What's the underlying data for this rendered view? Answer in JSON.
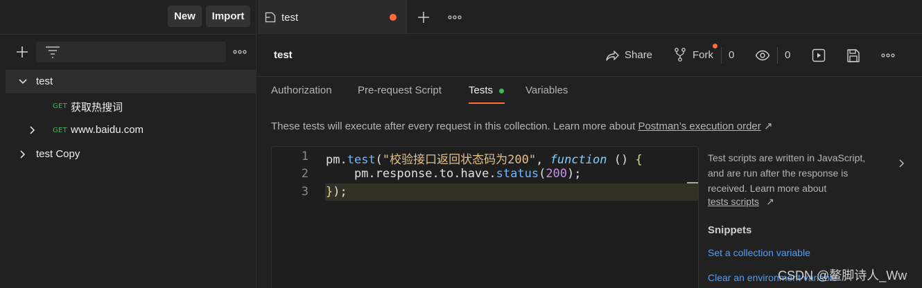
{
  "sidebar": {
    "new_label": "New",
    "import_label": "Import",
    "search_placeholder": "",
    "tree": [
      {
        "label": "test",
        "expanded": true
      },
      {
        "method": "GET",
        "label": "获取热搜词"
      },
      {
        "method": "GET",
        "label": "www.baidu.com",
        "expanded": false
      },
      {
        "label": "test Copy",
        "expanded": false
      }
    ]
  },
  "tabs": {
    "active_label": "test"
  },
  "header": {
    "title": "test",
    "share_label": "Share",
    "fork_label": "Fork",
    "fork_count": "0",
    "watch_count": "0"
  },
  "subtabs": [
    "Authorization",
    "Pre-request Script",
    "Tests",
    "Variables"
  ],
  "info": {
    "text": "These tests will execute after every request in this collection. Learn more about ",
    "link": "Postman’s execution order",
    "arrow": "↗"
  },
  "editor": {
    "line_numbers": [
      "1",
      "2",
      "3"
    ],
    "lines": [
      "pm.test(\"校验接口返回状态码为200\", function () {",
      "    pm.response.to.have.status(200);",
      "});"
    ]
  },
  "help": {
    "text": "Test scripts are written in JavaScript, and are run after the response is received. Learn more about",
    "link": "tests scripts",
    "arrow": "↗",
    "snippets_title": "Snippets",
    "snippets": [
      "Set a collection variable",
      "Clear an environment variable"
    ]
  },
  "watermark": "CSDN @鳌脚诗人_Ww",
  "colors": {
    "accent": "#ff6c37",
    "success": "#3fb950",
    "link": "#4d9efd"
  }
}
